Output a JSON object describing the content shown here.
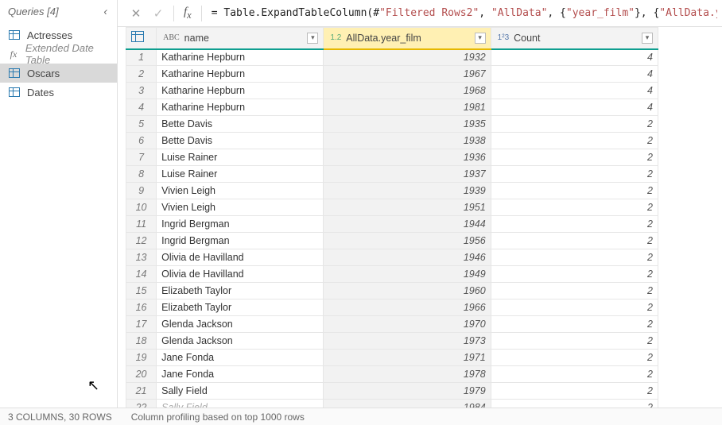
{
  "sidebar": {
    "title": "Queries [4]",
    "items": [
      {
        "label": "Actresses",
        "icon": "table",
        "dim": false,
        "selected": false
      },
      {
        "label": "Extended Date Table",
        "icon": "fx",
        "dim": true,
        "selected": false
      },
      {
        "label": "Oscars",
        "icon": "table",
        "dim": false,
        "selected": true
      },
      {
        "label": "Dates",
        "icon": "table",
        "dim": false,
        "selected": false
      }
    ]
  },
  "formula": {
    "prefix": "= ",
    "fn": "Table.ExpandTableColumn",
    "args_plain": "(#",
    "s1": "\"Filtered Rows2\"",
    "c1": ", ",
    "s2": "\"AllData\"",
    "c2": ", {",
    "s3": "\"year_film\"",
    "c3": "}, {",
    "s4": "\"AllData.year_film\"",
    "c4": "})"
  },
  "columns": [
    {
      "type": "ABC",
      "label": "name",
      "selected": false
    },
    {
      "type": "1.2",
      "label": "AllData.year_film",
      "selected": true
    },
    {
      "type": "1²3",
      "label": "Count",
      "selected": false
    }
  ],
  "rows": [
    {
      "n": 1,
      "name": "Katharine Hepburn",
      "year": 1932,
      "count": 4
    },
    {
      "n": 2,
      "name": "Katharine Hepburn",
      "year": 1967,
      "count": 4
    },
    {
      "n": 3,
      "name": "Katharine Hepburn",
      "year": 1968,
      "count": 4
    },
    {
      "n": 4,
      "name": "Katharine Hepburn",
      "year": 1981,
      "count": 4
    },
    {
      "n": 5,
      "name": "Bette Davis",
      "year": 1935,
      "count": 2
    },
    {
      "n": 6,
      "name": "Bette Davis",
      "year": 1938,
      "count": 2
    },
    {
      "n": 7,
      "name": "Luise Rainer",
      "year": 1936,
      "count": 2
    },
    {
      "n": 8,
      "name": "Luise Rainer",
      "year": 1937,
      "count": 2
    },
    {
      "n": 9,
      "name": "Vivien Leigh",
      "year": 1939,
      "count": 2
    },
    {
      "n": 10,
      "name": "Vivien Leigh",
      "year": 1951,
      "count": 2
    },
    {
      "n": 11,
      "name": "Ingrid Bergman",
      "year": 1944,
      "count": 2
    },
    {
      "n": 12,
      "name": "Ingrid Bergman",
      "year": 1956,
      "count": 2
    },
    {
      "n": 13,
      "name": "Olivia de Havilland",
      "year": 1946,
      "count": 2
    },
    {
      "n": 14,
      "name": "Olivia de Havilland",
      "year": 1949,
      "count": 2
    },
    {
      "n": 15,
      "name": "Elizabeth Taylor",
      "year": 1960,
      "count": 2
    },
    {
      "n": 16,
      "name": "Elizabeth Taylor",
      "year": 1966,
      "count": 2
    },
    {
      "n": 17,
      "name": "Glenda Jackson",
      "year": 1970,
      "count": 2
    },
    {
      "n": 18,
      "name": "Glenda Jackson",
      "year": 1973,
      "count": 2
    },
    {
      "n": 19,
      "name": "Jane Fonda",
      "year": 1971,
      "count": 2
    },
    {
      "n": 20,
      "name": "Jane Fonda",
      "year": 1978,
      "count": 2
    },
    {
      "n": 21,
      "name": "Sally Field",
      "year": 1979,
      "count": 2
    },
    {
      "n": 22,
      "name": "Sally Field",
      "year": 1984,
      "count": 2
    }
  ],
  "status": {
    "left": "3 COLUMNS, 30 ROWS",
    "mid": "Column profiling based on top 1000 rows"
  }
}
